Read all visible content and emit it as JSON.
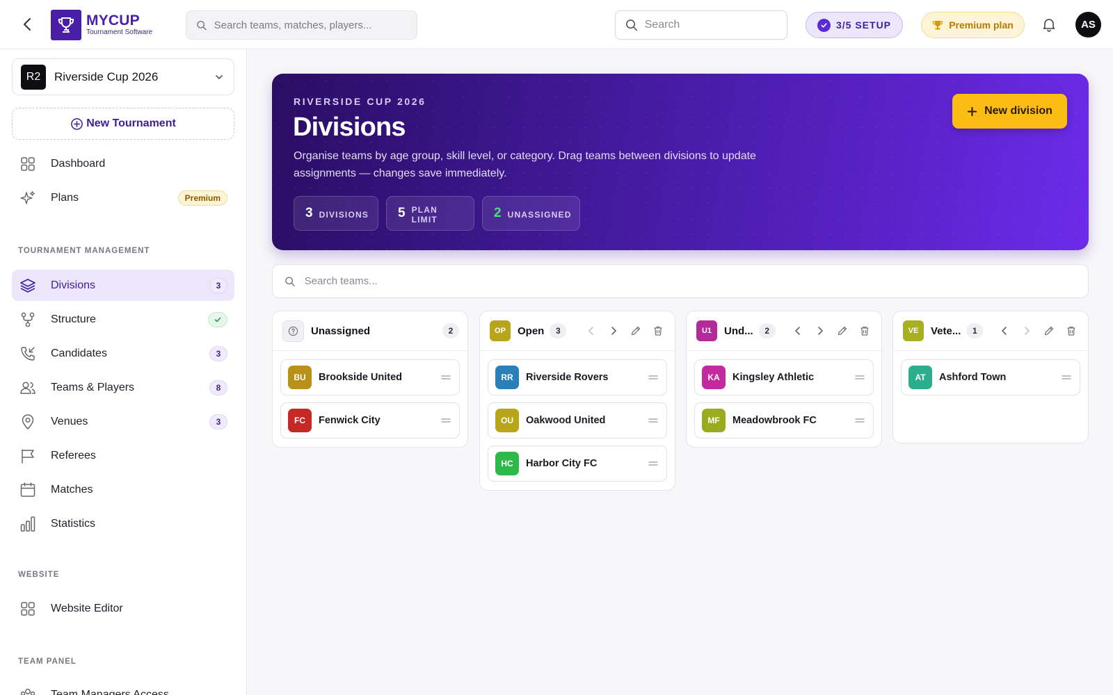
{
  "topbar": {
    "logo_title": "MYCUP",
    "logo_subtitle": "Tournament Software",
    "global_search_placeholder": "Search teams, matches, players...",
    "search_placeholder": "Search",
    "setup_label": "3/5 SETUP",
    "premium_label": "Premium plan",
    "avatar_initials": "AS"
  },
  "sidebar": {
    "tournament_badge": "R2",
    "tournament_name": "Riverside Cup 2026",
    "new_tournament_label": "New Tournament",
    "items": [
      {
        "label": "Dashboard",
        "icon": "grid-icon"
      },
      {
        "label": "Plans",
        "icon": "sparkles-icon",
        "badge": "Premium"
      }
    ],
    "section_tournament": "TOURNAMENT MANAGEMENT",
    "tm_items": [
      {
        "label": "Divisions",
        "icon": "layers-icon",
        "count": "3",
        "active": true
      },
      {
        "label": "Structure",
        "icon": "branch-icon",
        "status": "check"
      },
      {
        "label": "Candidates",
        "icon": "phone-incoming-icon",
        "count": "3"
      },
      {
        "label": "Teams & Players",
        "icon": "users-icon",
        "count": "8"
      },
      {
        "label": "Venues",
        "icon": "map-pin-icon",
        "count": "3"
      },
      {
        "label": "Referees",
        "icon": "flag-icon"
      },
      {
        "label": "Matches",
        "icon": "calendar-icon"
      },
      {
        "label": "Statistics",
        "icon": "bar-chart-icon"
      }
    ],
    "section_website": "WEBSITE",
    "website_items": [
      {
        "label": "Website Editor",
        "icon": "grid-icon"
      }
    ],
    "section_team_panel": "TEAM PANEL",
    "team_panel_items": [
      {
        "label": "Team Managers Access",
        "icon": "users-group-icon"
      }
    ]
  },
  "hero": {
    "eyebrow": "RIVERSIDE CUP 2026",
    "title": "Divisions",
    "description": "Organise teams by age group, skill level, or category. Drag teams between divisions to update assignments — changes save immediately.",
    "stats": [
      {
        "value": "3",
        "label": "DIVISIONS"
      },
      {
        "value": "5",
        "label": "PLAN LIMIT"
      },
      {
        "value": "2",
        "label": "UNASSIGNED"
      }
    ],
    "new_division_label": "New division"
  },
  "team_search_placeholder": "Search teams...",
  "columns": [
    {
      "title": "Unassigned",
      "count": "2",
      "avatar": null,
      "color": null,
      "teams": [
        {
          "initials": "BU",
          "name": "Brookside United",
          "color": "#b8901a"
        },
        {
          "initials": "FC",
          "name": "Fenwick City",
          "color": "#c62828"
        }
      ]
    },
    {
      "title": "Open",
      "count": "3",
      "avatar": "OP",
      "color": "#b8a51a",
      "teams": [
        {
          "initials": "RR",
          "name": "Riverside Rovers",
          "color": "#2a7fb8"
        },
        {
          "initials": "OU",
          "name": "Oakwood United",
          "color": "#b8a51a"
        },
        {
          "initials": "HC",
          "name": "Harbor City FC",
          "color": "#2fb84a"
        }
      ]
    },
    {
      "title": "Und...",
      "count": "2",
      "avatar": "U1",
      "color": "#b42a9a",
      "teams": [
        {
          "initials": "KA",
          "name": "Kingsley Athletic",
          "color": "#c42a9e"
        },
        {
          "initials": "MF",
          "name": "Meadowbrook FC",
          "color": "#9aab1f"
        }
      ]
    },
    {
      "title": "Vete...",
      "count": "1",
      "avatar": "VE",
      "color": "#a8b01f",
      "teams": [
        {
          "initials": "AT",
          "name": "Ashford Town",
          "color": "#2aae8c"
        }
      ]
    }
  ],
  "colors": {
    "brand": "#4a1fa8",
    "accent_yellow": "#fbbd14",
    "active_bg": "#ece6fb"
  }
}
